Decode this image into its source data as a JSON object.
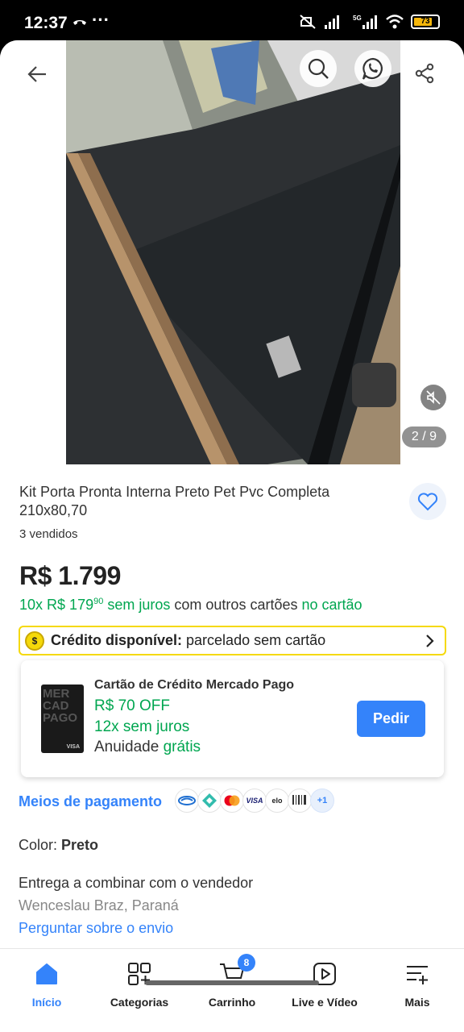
{
  "status": {
    "time": "12:37",
    "dots": "···",
    "battery": "73"
  },
  "gallery": {
    "counter": "2 / 9"
  },
  "product": {
    "title": "Kit Porta Pronta Interna Preto Pet Pvc Completa 210x80,70",
    "sold": "3 vendidos",
    "price": "R$ 1.799",
    "inst_count": "10x",
    "inst_value": "R$ 179",
    "inst_cents": "90",
    "inst_free": "sem juros",
    "inst_other": "com outros cartões",
    "inst_card": "no cartão"
  },
  "credit": {
    "coin": "$",
    "label": "Crédito disponível:",
    "text": "parcelado sem cartão"
  },
  "card_offer": {
    "card_lines": "MER CAD PAGO",
    "card_visa": "VISA",
    "title": "Cartão de Crédito Mercado Pago",
    "off": "R$ 70 OFF",
    "installments": "12x sem juros",
    "annuity_label": "Anuidade",
    "annuity_free": "grátis",
    "button": "Pedir"
  },
  "payment": {
    "link": "Meios de pagamento",
    "icons": [
      "caixa-icon",
      "pix-icon",
      "mastercard-icon",
      "visa-icon",
      "elo-icon",
      "boleto-icon"
    ],
    "visa_text": "VISA",
    "elo_text": "elo",
    "more": "+1"
  },
  "color": {
    "label": "Color:",
    "value": "Preto"
  },
  "shipping": {
    "delivery": "Entrega a combinar com o vendedor",
    "location": "Wenceslau Braz, Paraná",
    "ask": "Perguntar sobre o envio"
  },
  "tabs": {
    "home": "Início",
    "categories": "Categorias",
    "cart": "Carrinho",
    "cart_count": "8",
    "live": "Live e Vídeo",
    "more": "Mais"
  },
  "colors": {
    "accent": "#3483fa",
    "green": "#00a650",
    "yellow": "#f5d90a"
  }
}
